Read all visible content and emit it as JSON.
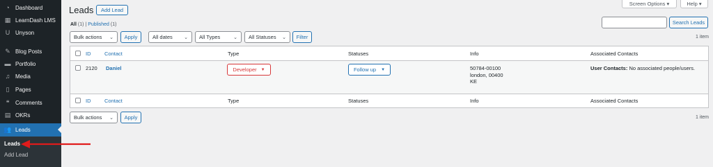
{
  "sidebar": {
    "items": [
      {
        "label": "Dashboard",
        "icon": "dashboard-icon",
        "glyph": "◔"
      },
      {
        "label": "LearnDash LMS",
        "icon": "learndash-icon",
        "glyph": "▦"
      },
      {
        "label": "Unyson",
        "icon": "unyson-icon",
        "glyph": "U"
      },
      {
        "label": "Blog Posts",
        "icon": "pin-icon",
        "glyph": "✎"
      },
      {
        "label": "Portfolio",
        "icon": "portfolio-icon",
        "glyph": "▬"
      },
      {
        "label": "Media",
        "icon": "media-icon",
        "glyph": "♫"
      },
      {
        "label": "Pages",
        "icon": "pages-icon",
        "glyph": "▯"
      },
      {
        "label": "Comments",
        "icon": "comments-icon",
        "glyph": "❝"
      },
      {
        "label": "OKRs",
        "icon": "okrs-icon",
        "glyph": "▤"
      },
      {
        "label": "Leads",
        "icon": "leads-icon",
        "glyph": "👥"
      }
    ],
    "submenu": [
      {
        "label": "Leads"
      },
      {
        "label": "Add Lead"
      }
    ]
  },
  "header": {
    "title": "Leads",
    "add_button": "Add Lead",
    "screen_options": "Screen Options ▾",
    "help": "Help ▾"
  },
  "views": {
    "all": "All",
    "all_count": "(1)",
    "separator": "|",
    "published": "Published",
    "published_count": "(1)"
  },
  "filters": {
    "bulk_actions": "Bulk actions",
    "apply": "Apply",
    "dates": "All dates",
    "types": "All Types",
    "statuses": "All Statuses",
    "filter": "Filter"
  },
  "search": {
    "button": "Search Leads",
    "value": ""
  },
  "items_count": "1 item",
  "table": {
    "columns": [
      "ID",
      "Contact",
      "Type",
      "Statuses",
      "Info",
      "Associated Contacts"
    ],
    "row": {
      "id": "2120",
      "contact": "Daniel",
      "type": "Developer",
      "status": "Follow up",
      "info_lines": [
        "50784-00100",
        "london, 00400",
        "KE"
      ],
      "assoc_label": "User Contacts:",
      "assoc_value": " No associated people/users."
    }
  },
  "colors": {
    "accent": "#2271b1",
    "sidebar_bg": "#1d2327",
    "danger": "#d63638",
    "annotation_arrow": "#e01b1b"
  }
}
